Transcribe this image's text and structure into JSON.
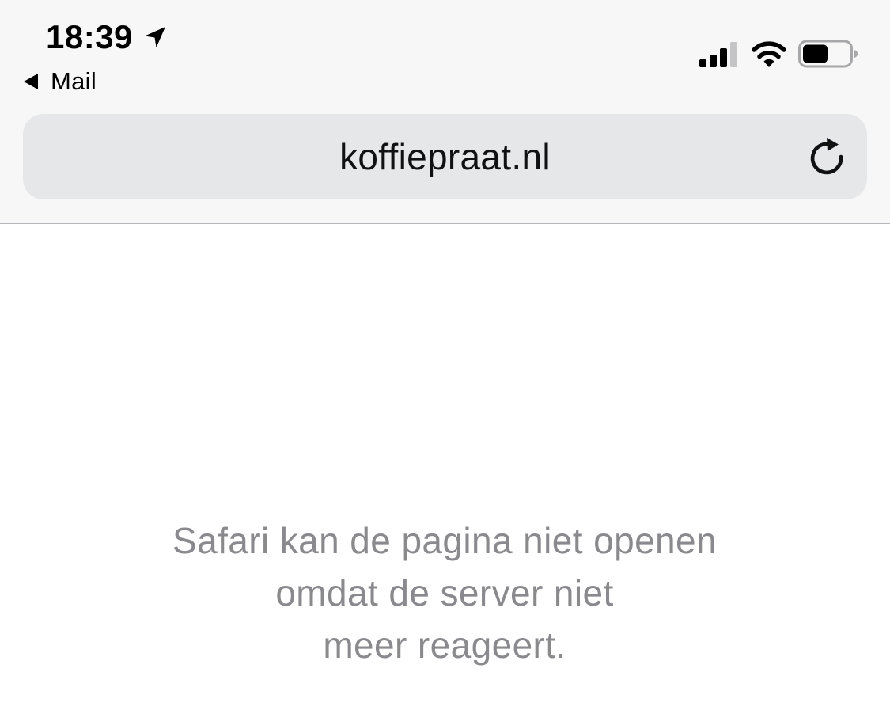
{
  "status_bar": {
    "time": "18:39",
    "back_app": "Mail",
    "icons": [
      "location-arrow-icon",
      "cellular-signal-icon",
      "wifi-icon",
      "battery-icon"
    ]
  },
  "address_bar": {
    "url": "koffiepraat.nl",
    "reload_icon": "reload-icon"
  },
  "content": {
    "error_lines": [
      "Safari kan de pagina niet openen",
      "omdat de server niet",
      "meer reageert."
    ],
    "text_color": "#8a8a8e"
  },
  "colors": {
    "chrome_background": "#f7f7f7",
    "address_bar_background": "#e6e7e9",
    "page_background": "#ffffff"
  }
}
